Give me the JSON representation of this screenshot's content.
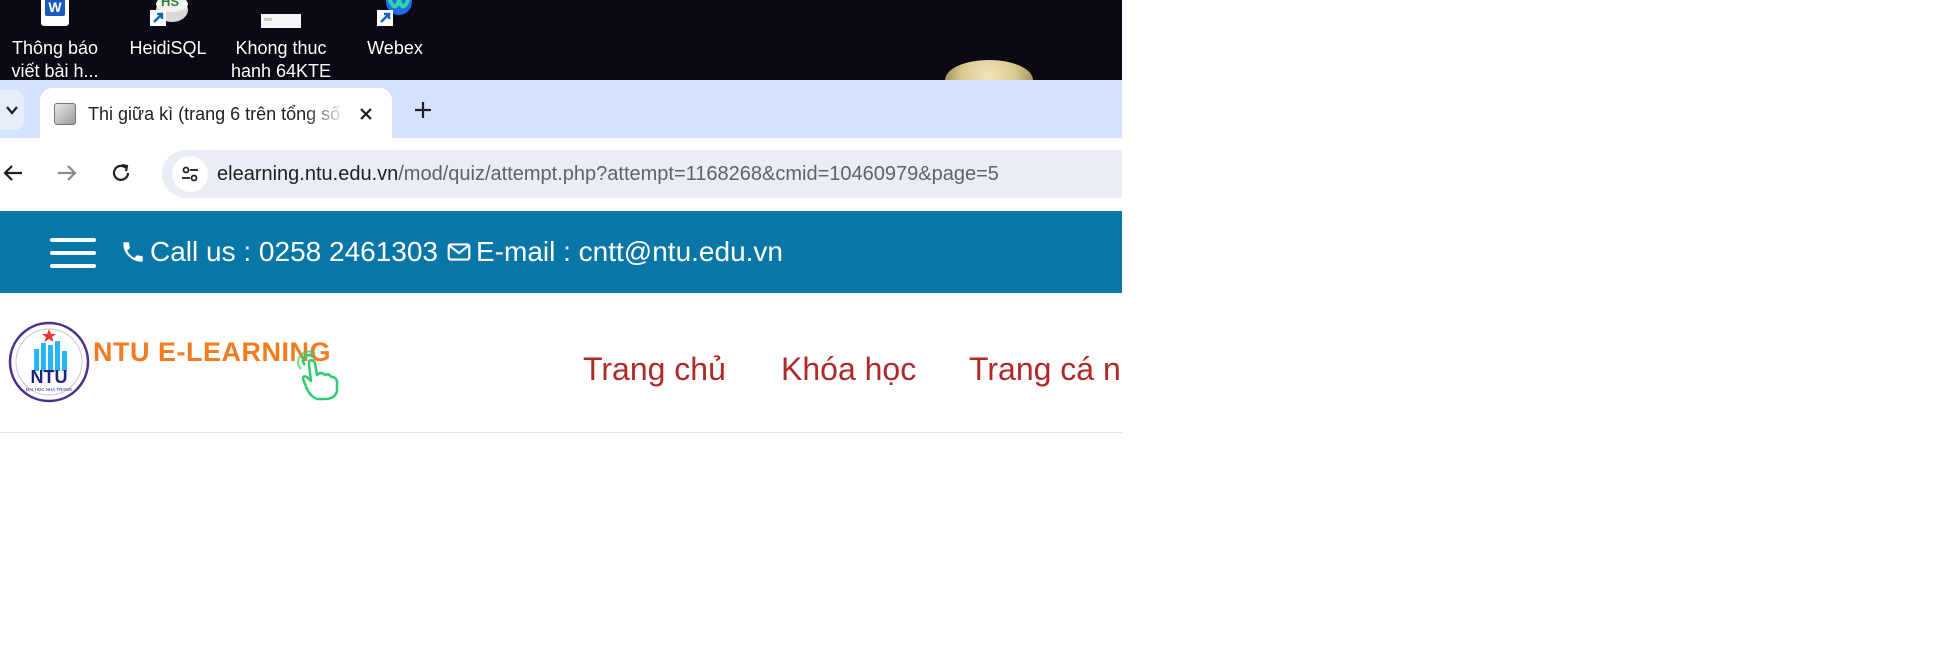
{
  "colors": {
    "desktop_bg": "#0c0914",
    "tabstrip_bg": "#d3e3fd",
    "contact_bar_bg": "#0976a8",
    "brand_orange": "#f47b20",
    "menu_red": "#b02828"
  },
  "desktop": {
    "icons": [
      {
        "label_line1": "Thông báo",
        "label_line2": "viết bài h...",
        "icon": "word-icon"
      },
      {
        "label_line1": "HeidiSQL",
        "label_line2": "",
        "icon": "heidisql-icon"
      },
      {
        "label_line1": "Khong thuc",
        "label_line2": "hanh 64KTE",
        "icon": "document-thumbnail-icon"
      },
      {
        "label_line1": "Webex",
        "label_line2": "",
        "icon": "webex-icon"
      }
    ],
    "heidisql_badge": "HS"
  },
  "browser": {
    "tab": {
      "title": "Thi giữa kì (trang 6 trên tổng số",
      "favicon": "moodle-favicon-icon",
      "close_glyph": "✕"
    },
    "new_tab_glyph": "+",
    "url_host": "elearning.ntu.edu.vn",
    "url_path": "/mod/quiz/attempt.php?attempt=1168268&cmid=10460979&page=5"
  },
  "site": {
    "contact": {
      "call_text": "Call us : 0258 2461303",
      "email_text": "E-mail : cntt@ntu.edu.vn"
    },
    "logo": {
      "brand_text": "NTU E-LEARNING",
      "seal_text": "NTU",
      "seal_subtext": "ĐẠI HỌC NHA TRANG"
    },
    "menu": [
      {
        "label": "Trang chủ"
      },
      {
        "label": "Khóa học"
      },
      {
        "label": "Trang cá n"
      }
    ]
  }
}
